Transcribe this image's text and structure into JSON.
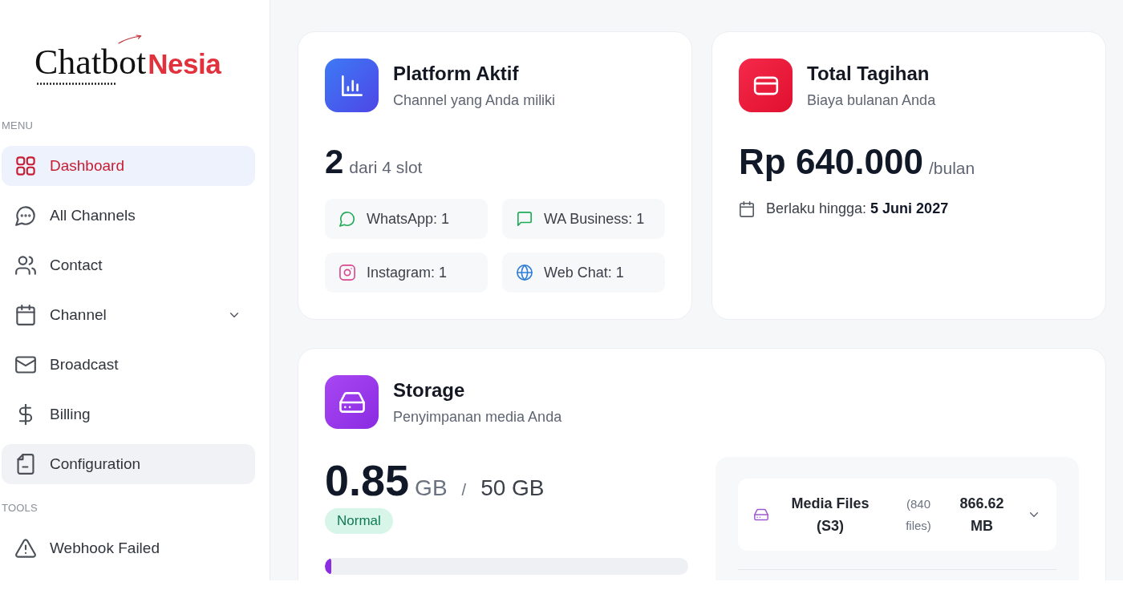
{
  "sidebar": {
    "logo": {
      "text": "Chatbot",
      "accent": "Nesia"
    },
    "sections": [
      {
        "label": "MENU",
        "items": [
          {
            "label": "Dashboard",
            "kind": "link",
            "selected": true,
            "hovered": false
          },
          {
            "label": "All Channels",
            "kind": "link",
            "selected": false,
            "hovered": false
          },
          {
            "label": "Contact",
            "kind": "link",
            "selected": false,
            "hovered": false
          },
          {
            "label": "Channel",
            "kind": "group",
            "selected": false,
            "hovered": false,
            "expanded": false
          },
          {
            "label": "Broadcast",
            "kind": "link",
            "selected": false,
            "hovered": false
          },
          {
            "label": "Billing",
            "kind": "link",
            "selected": false,
            "hovered": false
          },
          {
            "label": "Configuration",
            "kind": "link",
            "selected": false,
            "hovered": true
          }
        ]
      },
      {
        "label": "TOOLS",
        "items": [
          {
            "label": "Webhook Failed",
            "kind": "link",
            "selected": false,
            "hovered": false
          }
        ]
      }
    ]
  },
  "platform_card": {
    "title": "Platform Aktif",
    "subtitle": "Channel yang Anda miliki",
    "count": "2",
    "count_note": "dari 4 slot",
    "channels": [
      {
        "label": "WhatsApp: 1"
      },
      {
        "label": "WA Business: 1"
      },
      {
        "label": "Instagram: 1"
      },
      {
        "label": "Web Chat: 1"
      }
    ]
  },
  "billing_card": {
    "title": "Total Tagihan",
    "subtitle": "Biaya bulanan Anda",
    "amount": "Rp 640.000",
    "period": "/bulan",
    "validity": "Berlaku hingga: **5 Juni 2027**"
  },
  "storage_card": {
    "title": "Storage",
    "subtitle": "Penyimpanan media Anda",
    "used": "0.85",
    "used_unit": "GB",
    "separator": "/",
    "total": "50 GB",
    "status": "Normal",
    "level": 0.017,
    "breakdown": [
      {
        "name": "Media Files (S3)",
        "files": "(840 files)",
        "size": "866.62 MB",
        "expanded": false
      }
    ]
  }
}
